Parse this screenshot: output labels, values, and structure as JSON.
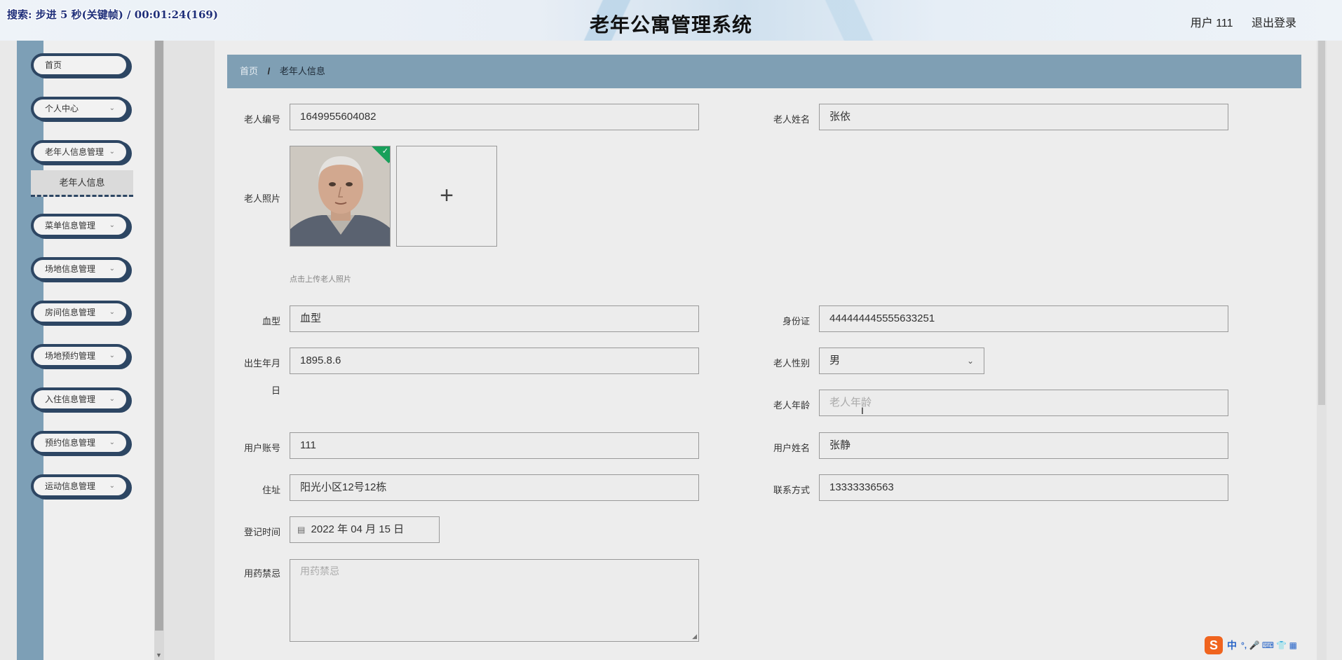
{
  "overlay": {
    "recording_text": "搜索: 步进 5 秒(关键帧) / 00:01:24(169)"
  },
  "header": {
    "title": "老年公寓管理系统",
    "user_label": "用户 111",
    "logout_label": "退出登录"
  },
  "sidebar": {
    "items": [
      {
        "label": "首页",
        "has_arrow": false
      },
      {
        "label": "个人中心",
        "has_arrow": true
      },
      {
        "label": "老年人信息管理",
        "has_arrow": true
      },
      {
        "label": "菜单信息管理",
        "has_arrow": true
      },
      {
        "label": "场地信息管理",
        "has_arrow": true
      },
      {
        "label": "房间信息管理",
        "has_arrow": true
      },
      {
        "label": "场地预约管理",
        "has_arrow": true
      },
      {
        "label": "入住信息管理",
        "has_arrow": true
      },
      {
        "label": "预约信息管理",
        "has_arrow": true
      },
      {
        "label": "运动信息管理",
        "has_arrow": true
      }
    ],
    "active_submenu": "老年人信息",
    "chevron": "⌄"
  },
  "breadcrumb": {
    "home": "首页",
    "separator": "/",
    "current": "老年人信息"
  },
  "form": {
    "elder_no": {
      "label": "老人编号",
      "value": "1649955604082"
    },
    "elder_name": {
      "label": "老人姓名",
      "value": "张依"
    },
    "photo": {
      "label": "老人照片",
      "hint": "点击上传老人照片",
      "upload_symbol": "+"
    },
    "blood_type": {
      "label": "血型",
      "value": "血型"
    },
    "id_card": {
      "label": "身份证",
      "value": "444444445555633251"
    },
    "birth_date": {
      "label_line1": "出生年月",
      "label_line2": "日",
      "value": "1895.8.6"
    },
    "gender": {
      "label": "老人性别",
      "value": "男"
    },
    "age": {
      "label": "老人年龄",
      "placeholder": "老人年龄"
    },
    "account": {
      "label": "用户账号",
      "value": "111"
    },
    "user_name": {
      "label": "用户姓名",
      "value": "张静"
    },
    "address": {
      "label": "住址",
      "value": "阳光小区12号12栋"
    },
    "contact": {
      "label": "联系方式",
      "value": "13333336563"
    },
    "register_time": {
      "label": "登记时间",
      "value": "2022 年 04 月 15 日"
    },
    "drug_taboo": {
      "label": "用药禁忌",
      "placeholder": "用药禁忌"
    }
  },
  "ime": {
    "logo": "S",
    "mode": "中",
    "symbols": "°, 🎤 ⌨ 👕 ▦"
  },
  "colors": {
    "sidebar_border": "#2d4663",
    "breadcrumb_bg": "#7f9fb4",
    "side_strip": "#7d9fb6",
    "photo_ok": "#18a05a"
  }
}
